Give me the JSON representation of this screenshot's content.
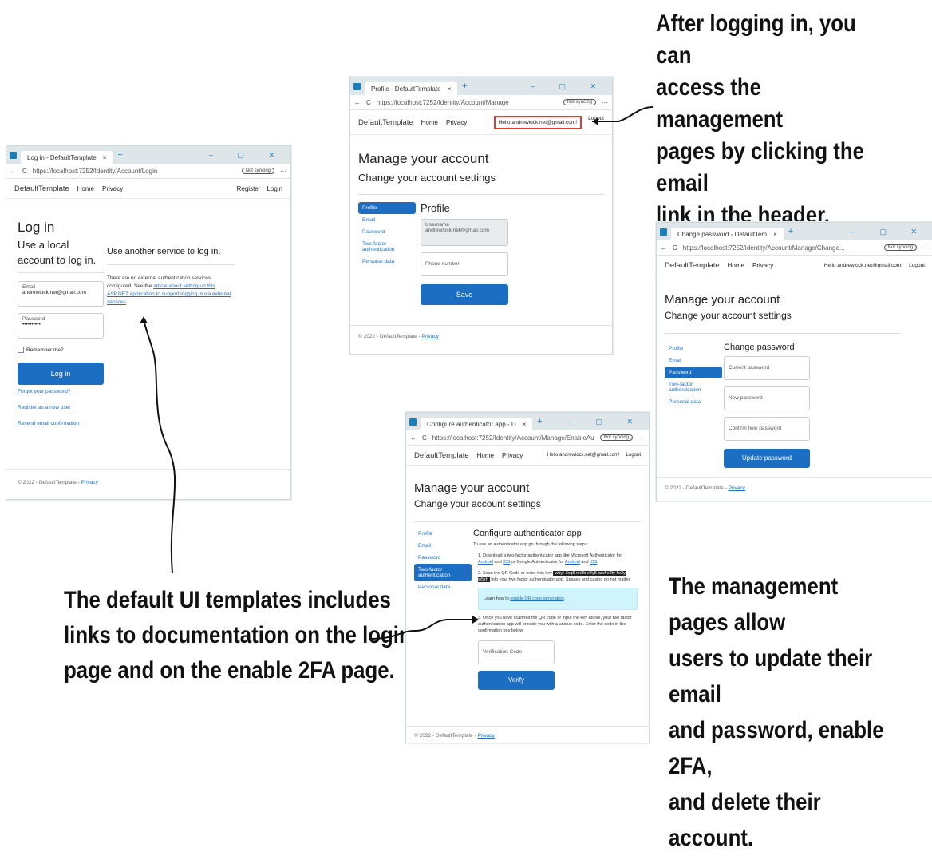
{
  "captions": {
    "top_right": [
      "After logging in, you can",
      "access the management",
      "pages by clicking the email",
      "link in the header."
    ],
    "bottom_left": [
      "The default UI templates includes",
      "links to documentation on the login",
      "page and on the enable 2FA page."
    ],
    "bottom_right": [
      "The management pages allow",
      "users to update their email",
      "and password, enable 2FA,",
      "and delete their account."
    ]
  },
  "browser": {
    "close_glyph": "×",
    "plus_glyph": "+",
    "controls": "–  ▢  ✕",
    "back": "←",
    "refresh": "C",
    "more": "···",
    "sync": "Not syncing"
  },
  "app": {
    "brand": "DefaultTemplate",
    "home": "Home",
    "privacy": "Privacy",
    "register": "Register",
    "login": "Login",
    "hello": "Hello andrewlock.net@gmail.com!",
    "logout": "Logout",
    "footer_text": "© 2022 - DefaultTemplate -",
    "footer_link": "Privacy",
    "manage_title": "Manage your account",
    "manage_subtitle": "Change your account settings",
    "sidebar": [
      "Profile",
      "Email",
      "Password",
      "Two-factor authentication",
      "Personal data"
    ]
  },
  "login_window": {
    "tab_title": "Log in - DefaultTemplate",
    "url": "https://localhost:7252/Identity/Account/Login",
    "title": "Log in",
    "local_heading": "Use a local account to log in.",
    "email_label": "Email",
    "email_value": "andrewlock.net@gmail.com",
    "password_label": "Password",
    "password_value": "••••••••••",
    "remember": "Remember me?",
    "login_button": "Log in",
    "forgot": "Forgot your password?",
    "register_new": "Register as a new user",
    "resend": "Resend email confirmation",
    "external_heading": "Use another service to log in.",
    "external_text_1": "There are no external authentication services configured. See",
    "external_text_2": "the",
    "external_link": "article about setting up this ASP.NET application to support logging in via external services",
    "external_end": "."
  },
  "profile_window": {
    "tab_title": "Profile - DefaultTemplate",
    "url": "https://localhost:7252/Identity/Account/Manage",
    "section": "Profile",
    "username_label": "Username",
    "username_value": "andrewlock.net@gmail.com",
    "phone_placeholder": "Phone number",
    "save": "Save"
  },
  "password_window": {
    "tab_title": "Change password - DefaultTem",
    "url": "https://localhost:7252/Identity/Account/Manage/Change...",
    "section": "Change password",
    "current": "Current password",
    "new": "New password",
    "confirm": "Confirm new password",
    "update": "Update password"
  },
  "twofa_window": {
    "tab_title": "Configure authenticator app - D",
    "url": "https://localhost:7252/Identity/Account/Manage/EnableAuthe...",
    "section": "Configure authenticator app",
    "intro": "To use an authenticator app go through the following steps:",
    "step1_a": "1. Download a two-factor authenticator app like Microsoft Authenticator for",
    "android": "Android",
    "and": "and",
    "ios": "iOS",
    "or": "or",
    "step1_b": "Google Authenticator for",
    "step2_a": "2. Scan the QR Code or enter this key",
    "key": "wbyr 3xq5 nh2b e4y5 zzvf e2ty fw3y w5zh",
    "step2_b": "into your two factor authenticator app. Spaces and casing do not matter.",
    "learn_a": "Learn how to",
    "learn_link": "enable QR code generation",
    "step3": "3. Once you have scanned the QR code or input the key above, your two factor authentication app will provide you with a unique code. Enter the code in the confirmation box below.",
    "code_placeholder": "Verification Code",
    "verify": "Verify"
  },
  "colors": {
    "accent": "#1b6ec2",
    "highlight_box": "#e53935",
    "info_bg": "#cff4fc"
  }
}
